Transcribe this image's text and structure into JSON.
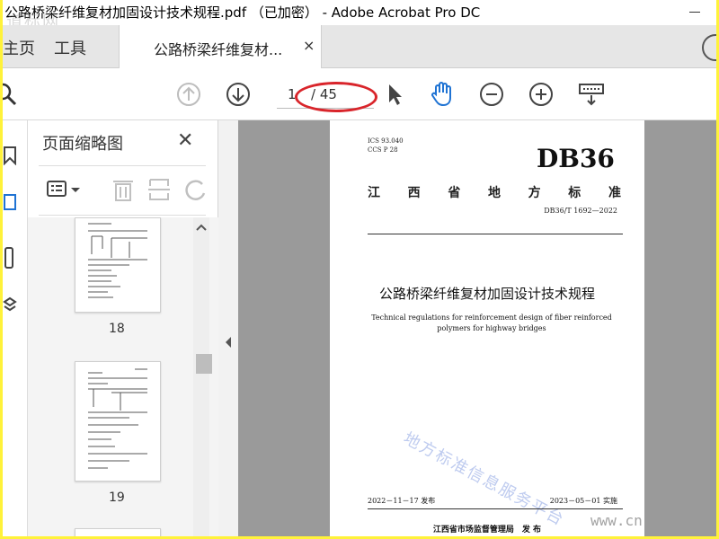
{
  "window": {
    "title": "公路桥梁纤维复材加固设计技术规程.pdf （已加密） - Adobe Acrobat Pro DC",
    "watermark_top": "道标网"
  },
  "tabs": {
    "home": "主页",
    "tools": "工具",
    "document_tab": "公路桥梁纤维复材...",
    "close_glyph": "×"
  },
  "toolbar": {
    "page_current": "1",
    "page_total": "/ 45",
    "icons": [
      "search-icon",
      "page-up-icon",
      "page-down-icon",
      "select-arrow-icon",
      "hand-tool-icon",
      "zoom-out-icon",
      "zoom-in-icon",
      "keyboard-tools-icon"
    ]
  },
  "sidebar": {
    "panel_title": "页面缩略图",
    "close_glyph": "✕",
    "thumbnails": [
      {
        "page_label": "18"
      },
      {
        "page_label": "19"
      }
    ]
  },
  "document": {
    "ics": "ICS 93.040",
    "ccs": "CCS P 28",
    "code": "DB36",
    "province_title": [
      "江",
      "西",
      "省",
      "地",
      "方",
      "标",
      "准"
    ],
    "standard_no": "DB36/T 1692—2022",
    "title_cn": "公路桥梁纤维复材加固设计技术规程",
    "title_en": "Technical regulations for reinforcement design of fiber reinforced polymers for highway bridges",
    "watermark": "地方标准信息服务平台",
    "issue_date": "2022－11－17 发布",
    "impl_date": "2023－05－01 实施",
    "publisher": "江西省市场监督管理局　发 布"
  },
  "corner_watermark": "www.cn",
  "colors": {
    "outer_border": "#fff23a",
    "annotation": "#d9252b",
    "hand_tool": "#1f73d3",
    "doc_background": "#9a9a9a"
  }
}
